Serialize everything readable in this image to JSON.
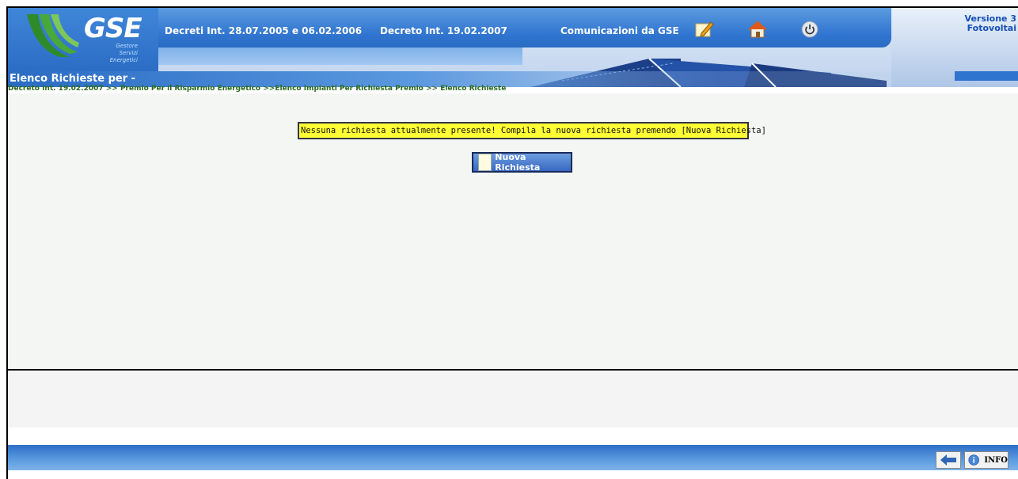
{
  "header": {
    "logo": "GSE",
    "logo_subtitle_1": "Gestore",
    "logo_subtitle_2": "Servizi",
    "logo_subtitle_3": "Energetici",
    "nav": [
      {
        "label": "Decreti Int. 28.07.2005 e 06.02.2006"
      },
      {
        "label": "Decreto Int. 19.02.2007"
      },
      {
        "label": "Comunicazioni da GSE"
      }
    ],
    "icons": [
      "edit-icon",
      "home-icon",
      "power-icon"
    ],
    "version_line1": "Versione 3",
    "version_line2": "Fotovoltai"
  },
  "page": {
    "title": "Elenco Richieste per -",
    "breadcrumb": "Decreto Int. 19.02.2007 >> Premio Per il Risparmio Energetico >>Elenco Impianti Per Richiesta Premio >> Elenco Richieste"
  },
  "main": {
    "message": "Nessuna richiesta attualmente presente! Compila la nuova richiesta premendo [Nuova Richiesta]",
    "new_request_label": "Nuova Richiesta"
  },
  "footer": {
    "back_icon": "back-arrow-icon",
    "info_icon": "info-icon",
    "info_label": "INFO"
  },
  "colors": {
    "primary_blue": "#2f74cf",
    "message_bg": "#ffff33",
    "breadcrumb_green": "#2b6b1b"
  }
}
